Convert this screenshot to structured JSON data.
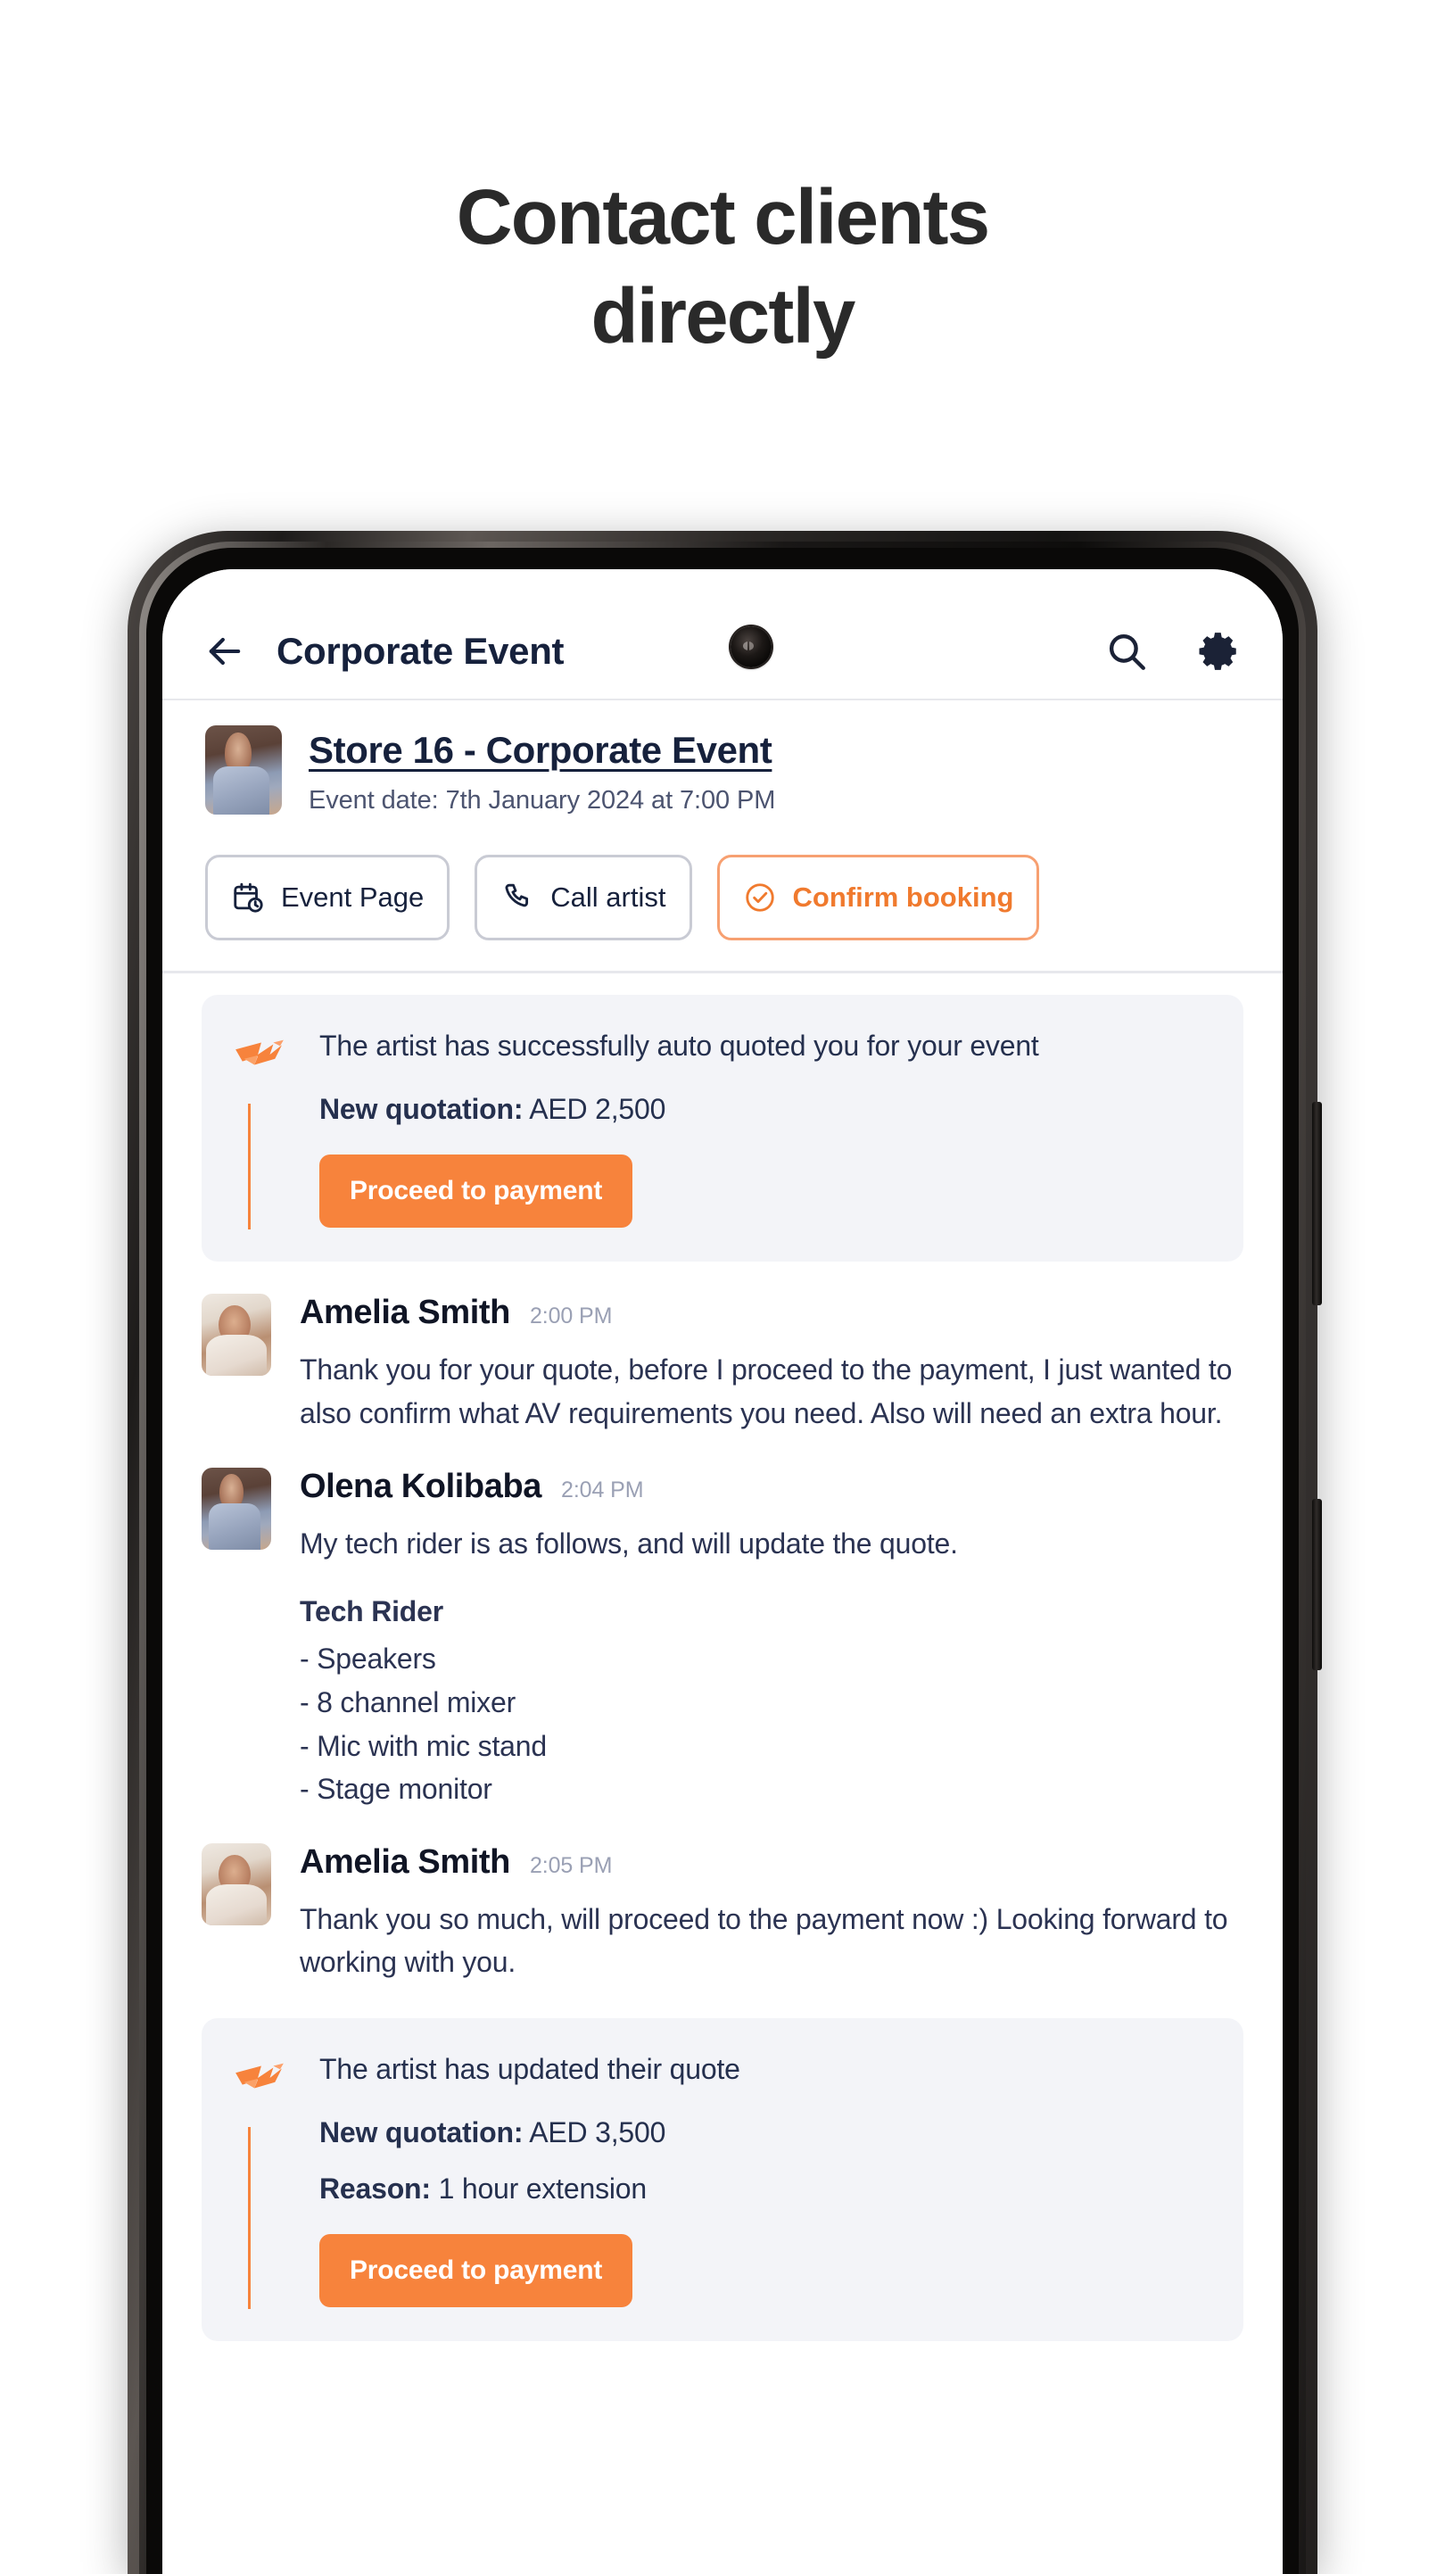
{
  "headline": {
    "line1": "Contact clients",
    "line2": "directly"
  },
  "appbar": {
    "back_icon": "arrow-left-icon",
    "title": "Corporate Event",
    "search_icon": "search-icon",
    "settings_icon": "gear-icon"
  },
  "event": {
    "title": "Store 16 - Corporate Event",
    "date": "Event date: 7th January 2024 at 7:00 PM",
    "thumbnail_alt": "artist-photo"
  },
  "actions": [
    {
      "label": "Event Page",
      "icon": "calendar-clock-icon",
      "style": "default"
    },
    {
      "label": "Call artist",
      "icon": "phone-icon",
      "style": "default"
    },
    {
      "label": "Confirm booking",
      "icon": "check-circle-icon",
      "style": "primary"
    }
  ],
  "feed": [
    {
      "type": "notification",
      "icon": "bird-logo-icon",
      "message": "The artist has successfully auto quoted you for your event",
      "quote_label": "New quotation:",
      "quote_value": "AED 2,500",
      "button": "Proceed to payment"
    },
    {
      "type": "message",
      "name": "Amelia Smith",
      "time": "2:00 PM",
      "avatar": "amelia",
      "text": "Thank you for your quote, before I proceed to the payment, I just wanted to also confirm what AV requirements you need. Also will need an extra hour."
    },
    {
      "type": "message",
      "name": "Olena Kolibaba",
      "time": "2:04 PM",
      "avatar": "olena",
      "text": "My tech rider is as follows, and will update the quote.",
      "subheading": "Tech Rider",
      "list": [
        "- Speakers",
        "- 8 channel mixer",
        "- Mic with mic stand",
        "- Stage monitor"
      ]
    },
    {
      "type": "message",
      "name": "Amelia Smith",
      "time": "2:05 PM",
      "avatar": "amelia",
      "text": "Thank you so much, will proceed to the payment now :) Looking forward to working with you."
    },
    {
      "type": "notification",
      "icon": "bird-logo-icon",
      "message": "The artist has updated their quote",
      "quote_label": "New quotation:",
      "quote_value": "AED 3,500",
      "reason_label": "Reason:",
      "reason_value": "1 hour extension",
      "button": "Proceed to payment"
    }
  ],
  "colors": {
    "accent_orange": "#f7833c",
    "accent_orange_border": "#f7a071",
    "text_dark": "#16213c",
    "text_body": "#2b3352",
    "muted": "#9aa0b4",
    "card_bg": "#f3f4f8"
  }
}
